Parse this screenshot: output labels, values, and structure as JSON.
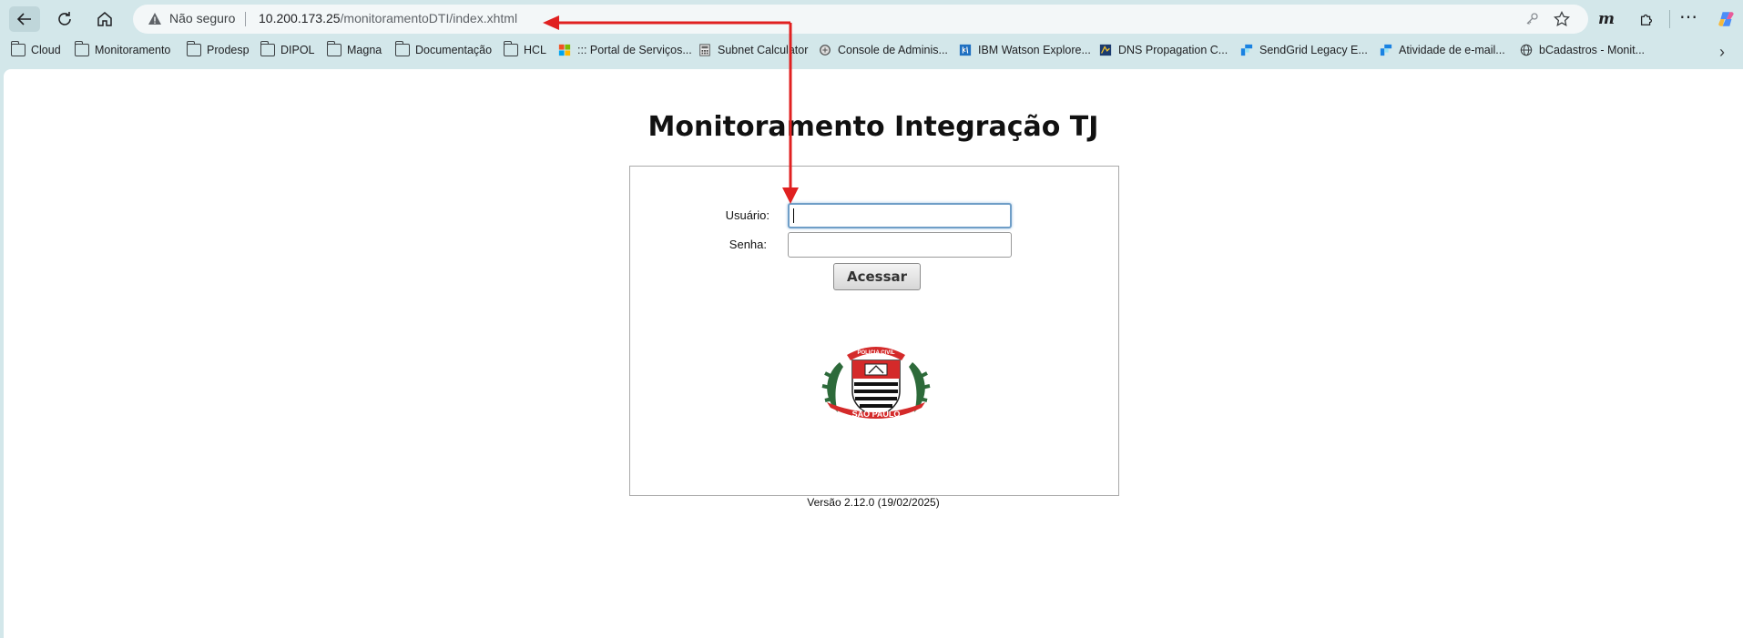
{
  "browser": {
    "address_bar": {
      "security_label": "Não seguro",
      "url_host": "10.200.173.25",
      "url_path": "/monitoramentoDTI/index.xhtml"
    },
    "bookmarks": [
      {
        "label": "Cloud",
        "icon": "folder-icon"
      },
      {
        "label": "Monitoramento",
        "icon": "folder-icon"
      },
      {
        "label": "Prodesp",
        "icon": "folder-icon"
      },
      {
        "label": "DIPOL",
        "icon": "folder-icon"
      },
      {
        "label": "Magna",
        "icon": "folder-icon"
      },
      {
        "label": "Documentação",
        "icon": "folder-icon"
      },
      {
        "label": "HCL",
        "icon": "folder-icon"
      },
      {
        "label": "::: Portal de Serviços...",
        "icon": "windows-logo-icon"
      },
      {
        "label": "Subnet Calculator",
        "icon": "calculator-icon"
      },
      {
        "label": "Console de Adminis...",
        "icon": "console-icon"
      },
      {
        "label": "IBM Watson Explore...",
        "icon": "ibm-icon"
      },
      {
        "label": "DNS Propagation C...",
        "icon": "dns-icon"
      },
      {
        "label": "SendGrid Legacy E...",
        "icon": "sendgrid-icon"
      },
      {
        "label": "Atividade de e-mail...",
        "icon": "sendgrid-icon"
      },
      {
        "label": "bCadastros - Monit...",
        "icon": "globe-icon"
      }
    ]
  },
  "page": {
    "title": "Monitoramento Integração TJ",
    "login": {
      "user_label": "Usuário:",
      "user_value": "",
      "password_label": "Senha:",
      "password_value": "",
      "submit_label": "Acessar"
    },
    "emblem": {
      "top_text": "POLICIA CIVIL",
      "bottom_text": "SÃO PAULO"
    },
    "version": "Versão 2.12.0 (19/02/2025)"
  },
  "colors": {
    "browser_chrome": "#d3e7ea",
    "annotation_arrow": "#e02020",
    "emblem_red": "#d42a2a",
    "emblem_green": "#2d6a3a"
  }
}
